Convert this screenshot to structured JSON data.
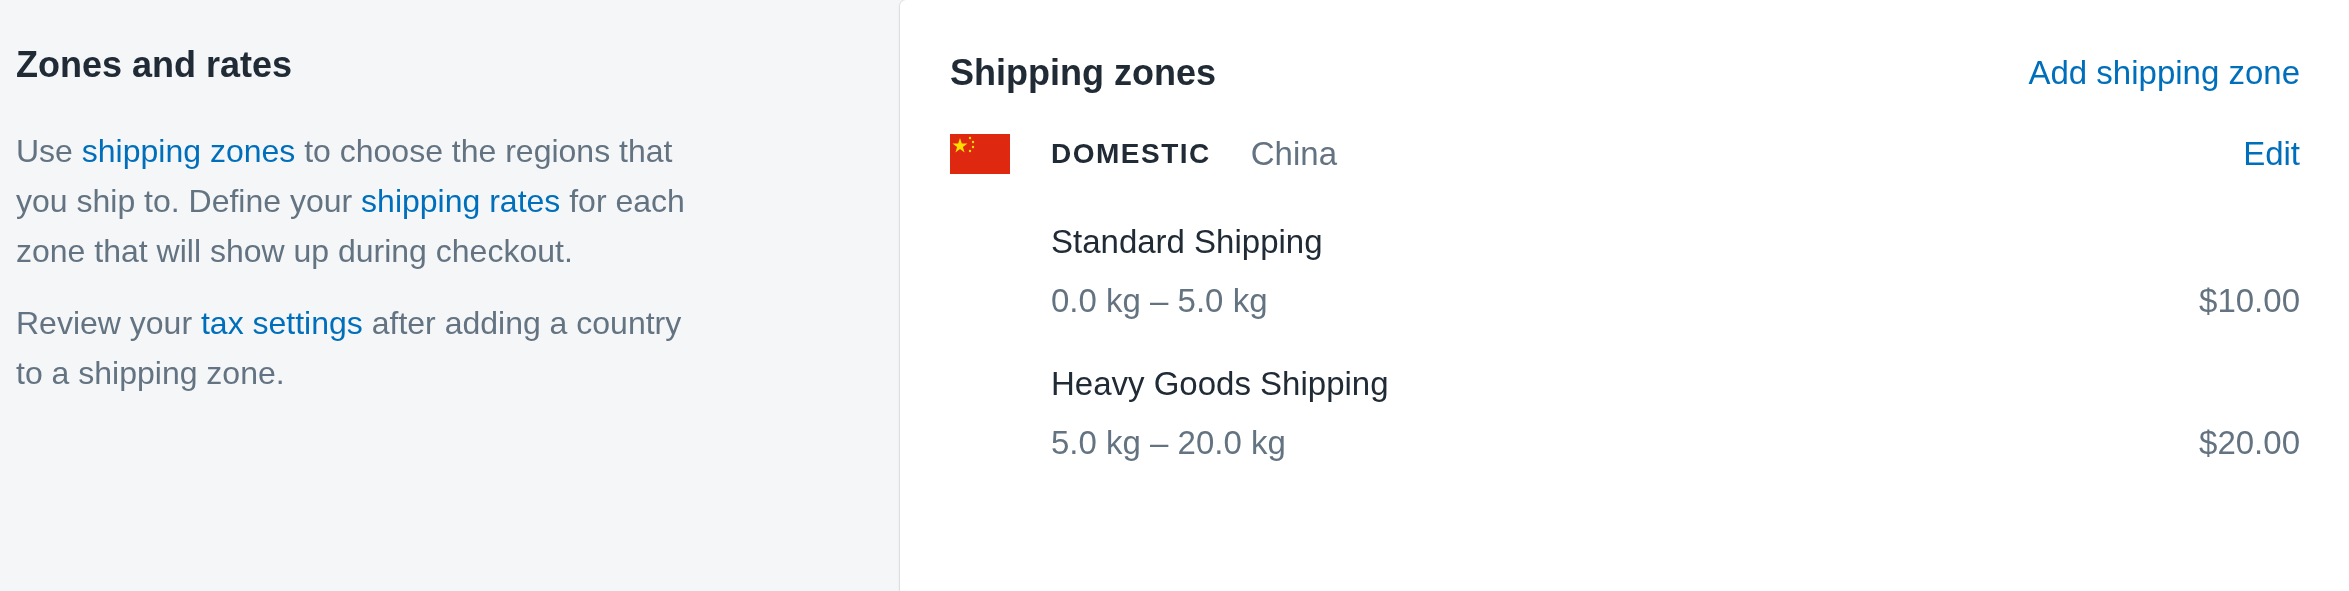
{
  "sidebar": {
    "title": "Zones and rates",
    "paragraphs": [
      [
        {
          "kind": "text",
          "text": "Use "
        },
        {
          "kind": "link",
          "text": "shipping zones"
        },
        {
          "kind": "text",
          "text": " to choose the regions that you ship to. Define your "
        },
        {
          "kind": "link",
          "text": "shipping rates"
        },
        {
          "kind": "text",
          "text": " for each zone that will show up during checkout."
        }
      ],
      [
        {
          "kind": "text",
          "text": "Review your "
        },
        {
          "kind": "link",
          "text": "tax settings"
        },
        {
          "kind": "text",
          "text": " after adding a country to a shipping zone."
        }
      ]
    ]
  },
  "card": {
    "title": "Shipping zones",
    "action": "Add shipping zone",
    "zones": [
      {
        "name": "DOMESTIC",
        "countries": "China",
        "action": "Edit",
        "rates": [
          {
            "name": "Standard Shipping",
            "range": "0.0 kg – 5.0 kg",
            "price": "$10.00"
          },
          {
            "name": "Heavy Goods Shipping",
            "range": "5.0 kg – 20.0 kg",
            "price": "$20.00"
          }
        ]
      }
    ]
  }
}
